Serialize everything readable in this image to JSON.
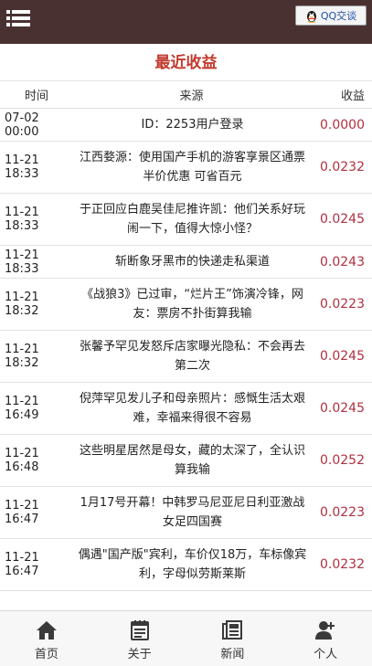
{
  "header": {
    "menu_icon": "hamburger-menu-icon",
    "qq_button_label": "QQ交谈",
    "qq_icon": "qq-penguin-icon"
  },
  "page": {
    "title": "最近收益"
  },
  "table": {
    "columns": {
      "time": "时间",
      "source": "来源",
      "income": "收益"
    },
    "rows": [
      {
        "time": "07-02 00:00",
        "source": "ID：2253用户登录",
        "income": "0.0000"
      },
      {
        "time": "11-21 18:33",
        "source": "江西婺源：使用国产手机的游客享景区通票半价优惠 可省百元",
        "income": "0.0232"
      },
      {
        "time": "11-21 18:33",
        "source": "于正回应白鹿吴佳尼推许凯：他们关系好玩闹一下，值得大惊小怪？",
        "income": "0.0245"
      },
      {
        "time": "11-21 18:33",
        "source": "斩断象牙黑市的快递走私渠道",
        "income": "0.0243"
      },
      {
        "time": "11-21 18:32",
        "source": "《战狼3》已过审，“烂片王”饰演冷锋，网友：票房不扑街算我输",
        "income": "0.0223"
      },
      {
        "time": "11-21 18:32",
        "source": "张馨予罕见发怒斥店家曝光隐私：不会再去第二次",
        "income": "0.0245"
      },
      {
        "time": "11-21 16:49",
        "source": "倪萍罕见发儿子和母亲照片：感慨生活太艰难，幸福来得很不容易",
        "income": "0.0245"
      },
      {
        "time": "11-21 16:48",
        "source": "这些明星居然是母女，藏的太深了，全认识算我输",
        "income": "0.0252"
      },
      {
        "time": "11-21 16:47",
        "source": "1月17号开幕！中韩罗马尼亚尼日利亚激战女足四国赛",
        "income": "0.0223"
      },
      {
        "time": "11-21 16:47",
        "source": "偶遇\"国产版\"宾利，车价仅18万，车标像宾利，字母似劳斯莱斯",
        "income": "0.0232"
      }
    ]
  },
  "tabbar": {
    "items": [
      {
        "label": "首页",
        "icon": "home-icon"
      },
      {
        "label": "关于",
        "icon": "notepad-icon"
      },
      {
        "label": "新闻",
        "icon": "newspaper-icon"
      },
      {
        "label": "个人",
        "icon": "add-user-icon"
      }
    ]
  },
  "colors": {
    "topbar": "#4a3131",
    "title": "#c0392b",
    "income": "#b03040"
  }
}
